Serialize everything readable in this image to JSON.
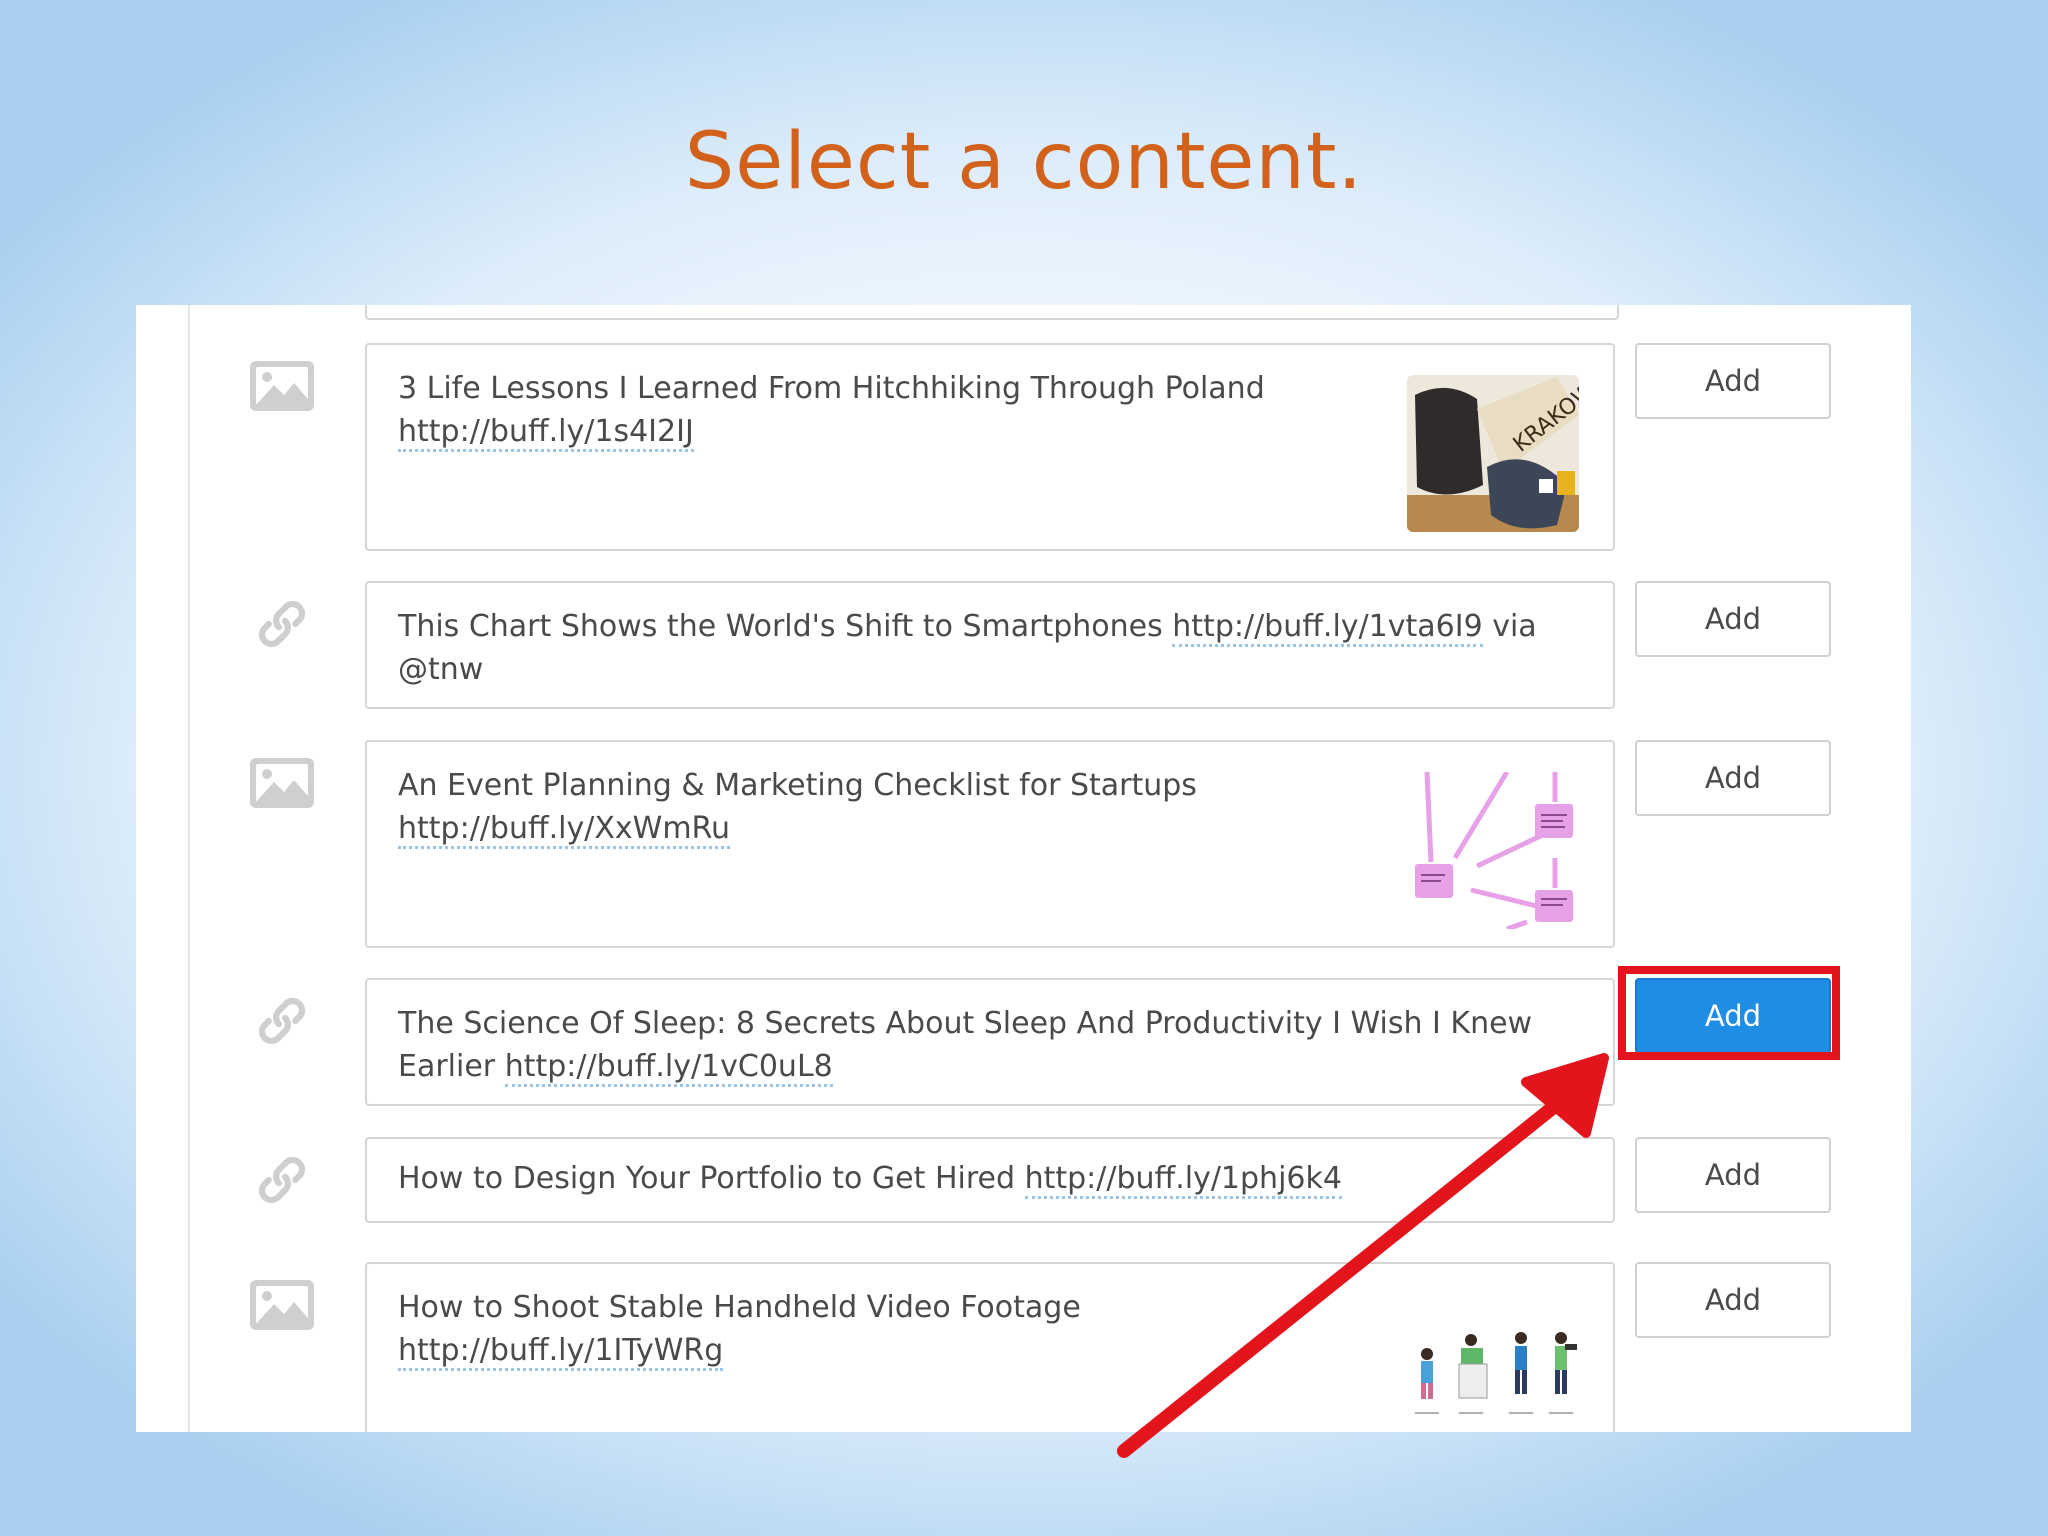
{
  "slide": {
    "title": "Select a content."
  },
  "items": [
    {
      "type_icon": "image-icon",
      "text": "3 Life Lessons I Learned From Hitchhiking Through Poland",
      "link": "http://buff.ly/1s4I2IJ",
      "thumbnail": "backpack-krakow-sign-photo",
      "add_label": "Add"
    },
    {
      "type_icon": "link-icon",
      "text": "This Chart Shows the World's Shift to Smartphones",
      "link": "http://buff.ly/1vta6I9",
      "suffix": "via @tnw",
      "add_label": "Add"
    },
    {
      "type_icon": "image-icon",
      "text": "An Event Planning & Marketing Checklist for Startups",
      "link": "http://buff.ly/XxWmRu",
      "thumbnail": "pink-flowchart-diagram",
      "add_label": "Add"
    },
    {
      "type_icon": "link-icon",
      "text": "The Science Of Sleep: 8 Secrets About Sleep And Productivity I Wish I Knew Earlier",
      "link": "http://buff.ly/1vC0uL8",
      "add_label": "Add",
      "highlighted": true
    },
    {
      "type_icon": "link-icon",
      "text": "How to Design Your Portfolio to Get Hired",
      "link": "http://buff.ly/1phj6k4",
      "add_label": "Add"
    },
    {
      "type_icon": "image-icon",
      "text": "How to Shoot Stable Handheld Video Footage",
      "link": "http://buff.ly/1ITyWRg",
      "thumbnail": "videographer-poses-illustration",
      "add_label": "Add"
    }
  ],
  "colors": {
    "title": "#d2611c",
    "primary_button": "#1f8de3",
    "annotation_red": "#e3141b",
    "link_underline": "#9bc3e6"
  }
}
